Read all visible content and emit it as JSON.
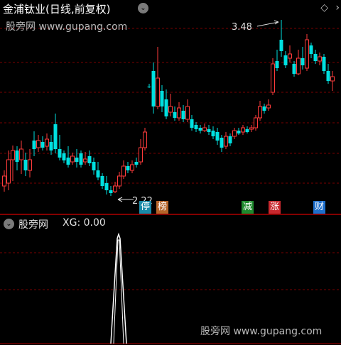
{
  "header": {
    "title": "金浦钛业(日线,前复权)",
    "watermark": "股旁网 www.gupang.com"
  },
  "price_annotations": {
    "high_label": "3.48",
    "low_label": "2.22"
  },
  "badges": [
    {
      "label": "停",
      "color": "#1a8aa8"
    },
    {
      "label": "榜",
      "color": "#b5652a"
    },
    {
      "label": "减",
      "color": "#1f8a2e"
    },
    {
      "label": "涨",
      "color": "#c8282e"
    },
    {
      "label": "财",
      "color": "#1e6fcc"
    }
  ],
  "indicator": {
    "name": "股旁网",
    "value_text": "XG: 0.00"
  },
  "footer": {
    "watermark": "股旁网 www.gupang.com"
  },
  "colors": {
    "up": "#ff3b3b",
    "down": "#00e0e0",
    "grid": "#7a0000",
    "divider": "#b00000",
    "spike": "#ffffff"
  }
}
